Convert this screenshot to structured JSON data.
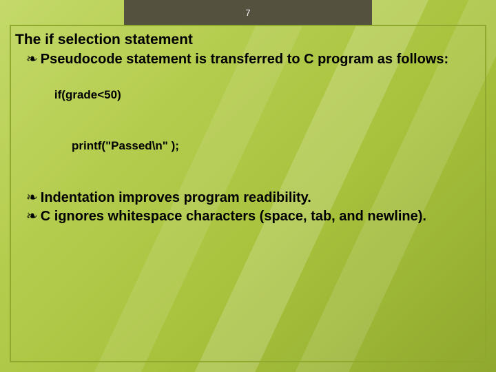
{
  "page_number": "7",
  "title": "The if selection statement",
  "bullets": {
    "b1": "Pseudocode statement is transferred to C program as follows:",
    "b2": "Indentation improves program readibility.",
    "b3": "C ignores whitespace characters (space, tab, and newline)."
  },
  "code": {
    "line1": "if(grade<50)",
    "line2": "printf(\"Passed\\n\" );"
  },
  "glyphs": {
    "bullet": "❧"
  }
}
